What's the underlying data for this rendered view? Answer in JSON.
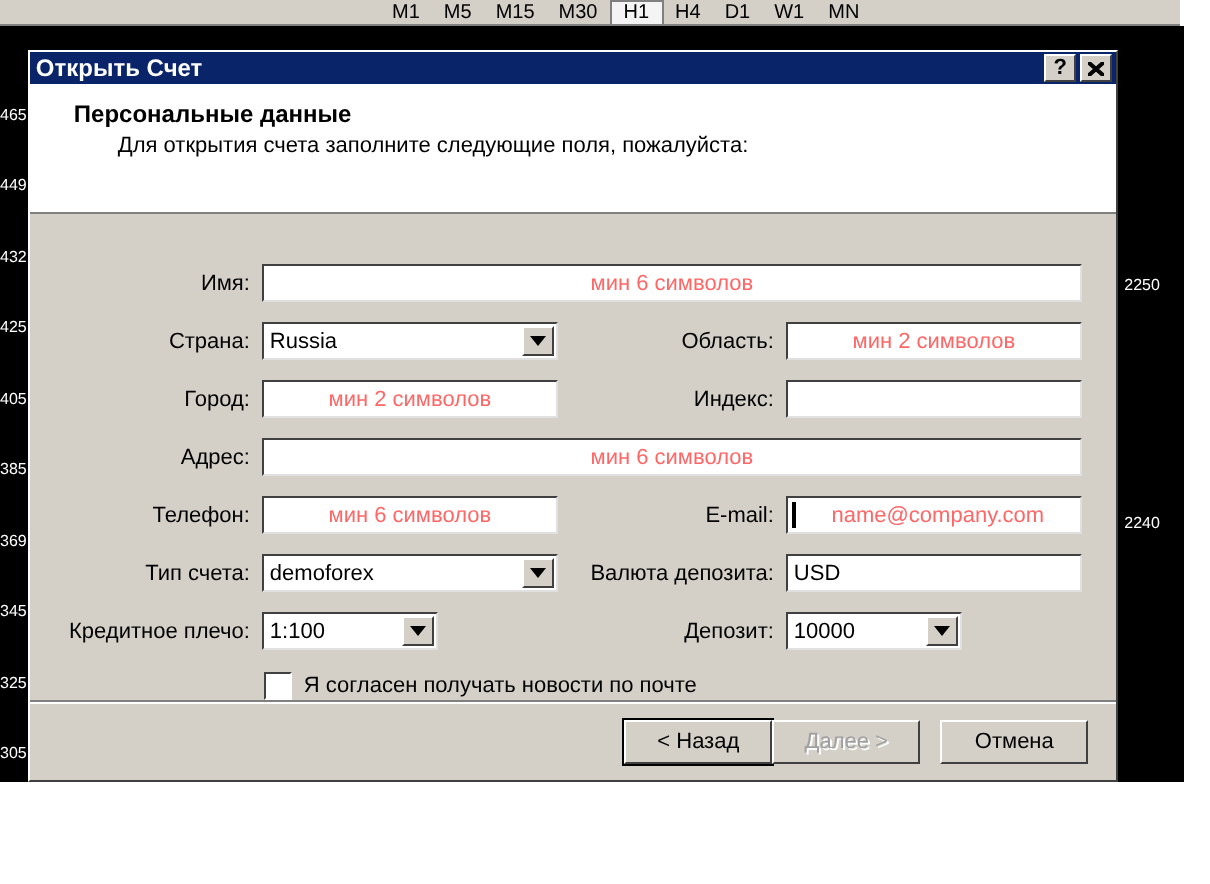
{
  "toolbar": {
    "timeframes": [
      {
        "label": "M1",
        "selected": false
      },
      {
        "label": "M5",
        "selected": false
      },
      {
        "label": "M15",
        "selected": false
      },
      {
        "label": "M30",
        "selected": false
      },
      {
        "label": "H1",
        "selected": true
      },
      {
        "label": "H4",
        "selected": false
      },
      {
        "label": "D1",
        "selected": false
      },
      {
        "label": "W1",
        "selected": false
      },
      {
        "label": "MN",
        "selected": false
      }
    ]
  },
  "chart": {
    "left_axis": [
      "465",
      "449",
      "432",
      "425",
      "405",
      "385",
      "369",
      "345",
      "325",
      "305"
    ],
    "right_axis": [
      "2250",
      "2240"
    ]
  },
  "dialog": {
    "title": "Открыть Счет",
    "help_button": "?",
    "header": {
      "title": "Персональные данные",
      "subtitle": "Для открытия счета заполните следующие поля, пожалуйста:"
    },
    "rows": [
      [
        {
          "kind": "wide",
          "label": "Имя:",
          "placeholder": "мин 6 символов",
          "focused": false
        }
      ],
      [
        {
          "kind": "select",
          "label": "Страна:",
          "value": "Russia",
          "focused": false
        },
        {
          "kind": "text",
          "label": "Область:",
          "placeholder": "мин 2 символов",
          "focused": false
        }
      ],
      [
        {
          "kind": "text",
          "label": "Город:",
          "placeholder": "мин 2 символов",
          "focused": false
        },
        {
          "kind": "text",
          "label": "Индекс:",
          "focused": false
        }
      ],
      [
        {
          "kind": "wide",
          "label": "Адрес:",
          "placeholder": "мин 6 символов",
          "focused": false
        }
      ],
      [
        {
          "kind": "text",
          "label": "Телефон:",
          "placeholder": "мин 6 символов",
          "focused": false
        },
        {
          "kind": "text",
          "label": "E-mail:",
          "placeholder": "name@company.com",
          "focused": true
        }
      ],
      [
        {
          "kind": "select",
          "label": "Тип счета:",
          "value": "demoforex",
          "focused": false
        },
        {
          "kind": "text",
          "label": "Валюта депозита:",
          "value": "USD",
          "focused": false
        }
      ],
      [
        {
          "kind": "short_select",
          "label": "Кредитное плечо:",
          "value": "1:100",
          "focused": false
        },
        {
          "kind": "short_select",
          "label": "Депозит:",
          "value": "10000",
          "focused": false
        }
      ]
    ],
    "subscribe": {
      "label": "Я согласен получать новости по почте",
      "checked": false
    },
    "buttons": [
      {
        "label": "< Назад",
        "disabled": false,
        "default": true
      },
      {
        "label": "Далее >",
        "disabled": true,
        "default": false
      },
      {
        "label": "Отмена",
        "disabled": false,
        "default": false
      }
    ]
  }
}
